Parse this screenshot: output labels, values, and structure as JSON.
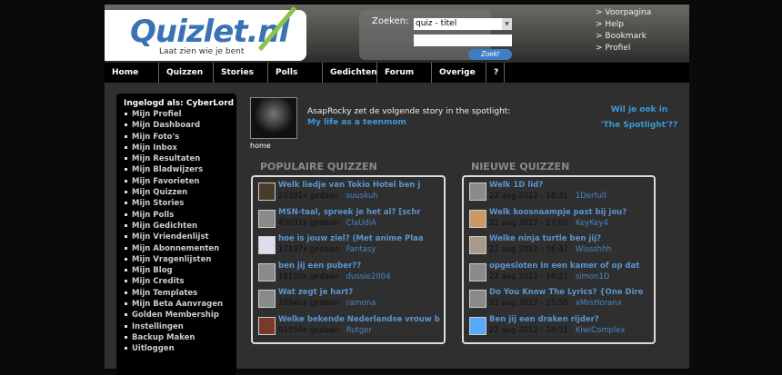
{
  "logo": {
    "name": "Quizlet.nl",
    "tagline": "Laat zien wie je bent"
  },
  "search": {
    "label": "Zoeken:",
    "selected": "quiz - titel",
    "value": "",
    "button": "Zoek!"
  },
  "toplinks": [
    "> Voorpagina",
    "> Help",
    "> Bookmark",
    "> Profiel"
  ],
  "nav": [
    "Home",
    "Quizzen",
    "Stories",
    "Polls",
    "Gedichten",
    "Forum",
    "Overige",
    "?"
  ],
  "sidebar": {
    "title": "Ingelogd als: CyberLord",
    "items": [
      "Mijn Profiel",
      "Mijn Dashboard",
      "Mijn Foto's",
      "Mijn Inbox",
      "Mijn Resultaten",
      "Mijn Bladwijzers",
      "Mijn Favorieten",
      "Mijn Quizzen",
      "Mijn Stories",
      "Mijn Polls",
      "Mijn Gedichten",
      "Mijn Vriendenlijst",
      "Mijn Abonnementen",
      "Mijn Vragenlijsten",
      "Mijn Blog",
      "Mijn Credits",
      "Mijn Templates",
      "Mijn Beta Aanvragen",
      "Golden Membership",
      "Instellingen",
      "Backup Maken",
      "Uitloggen"
    ]
  },
  "spotlight": {
    "text": "AsapRocky zet de volgende story in the spotlight:",
    "link": "My life as a teenmom",
    "home": "home",
    "want1": "Wil je ook in",
    "want2": "'The Spotlight'??"
  },
  "popular": {
    "title": "POPULAIRE QUIZZEN",
    "items": [
      {
        "title": "Welk liedje van Tokio Hotel ben j",
        "meta": "24391x gedaan",
        "user": "suuskuh"
      },
      {
        "title": "MSN-taal, spreek je het al? [schr",
        "meta": "45031x gedaan",
        "user": "ClaUdiA"
      },
      {
        "title": "hoe is jouw ziel? (Met anime Plaa",
        "meta": "17187x gedaan",
        "user": "Fantasy"
      },
      {
        "title": "ben jij een puber??",
        "meta": "18150x gedaan",
        "user": "dussie2004"
      },
      {
        "title": "Wat zegt je hart?",
        "meta": "10940x gedaan",
        "user": "ramona"
      },
      {
        "title": "Welke bekende Nederlandse vrouw b",
        "meta": "61956x gedaan",
        "user": "Rutger"
      }
    ]
  },
  "newest": {
    "title": "NIEUWE QUIZZEN",
    "items": [
      {
        "title": "Welk 1D lid?",
        "meta": "22 aug 2012 - 18:31",
        "user": "1Derfull"
      },
      {
        "title": "Welk koosnaampje past bij jou?",
        "meta": "22 aug 2012 - 17:05",
        "user": "KeyKey4"
      },
      {
        "title": "Welke ninja turtle ben jij?",
        "meta": "22 aug 2012 - 16:47",
        "user": "Wissshhh"
      },
      {
        "title": "opgesloten in een kamer of op dat",
        "meta": "22 aug 2012 - 16:21",
        "user": "simon1D"
      },
      {
        "title": "Do You Know The Lyrics? {One Dire",
        "meta": "22 aug 2012 - 15:56",
        "user": "xMrsHoranx"
      },
      {
        "title": "Ben jij een draken rijder?",
        "meta": "22 aug 2012 - 14:51",
        "user": "KiwiComplex"
      }
    ]
  }
}
